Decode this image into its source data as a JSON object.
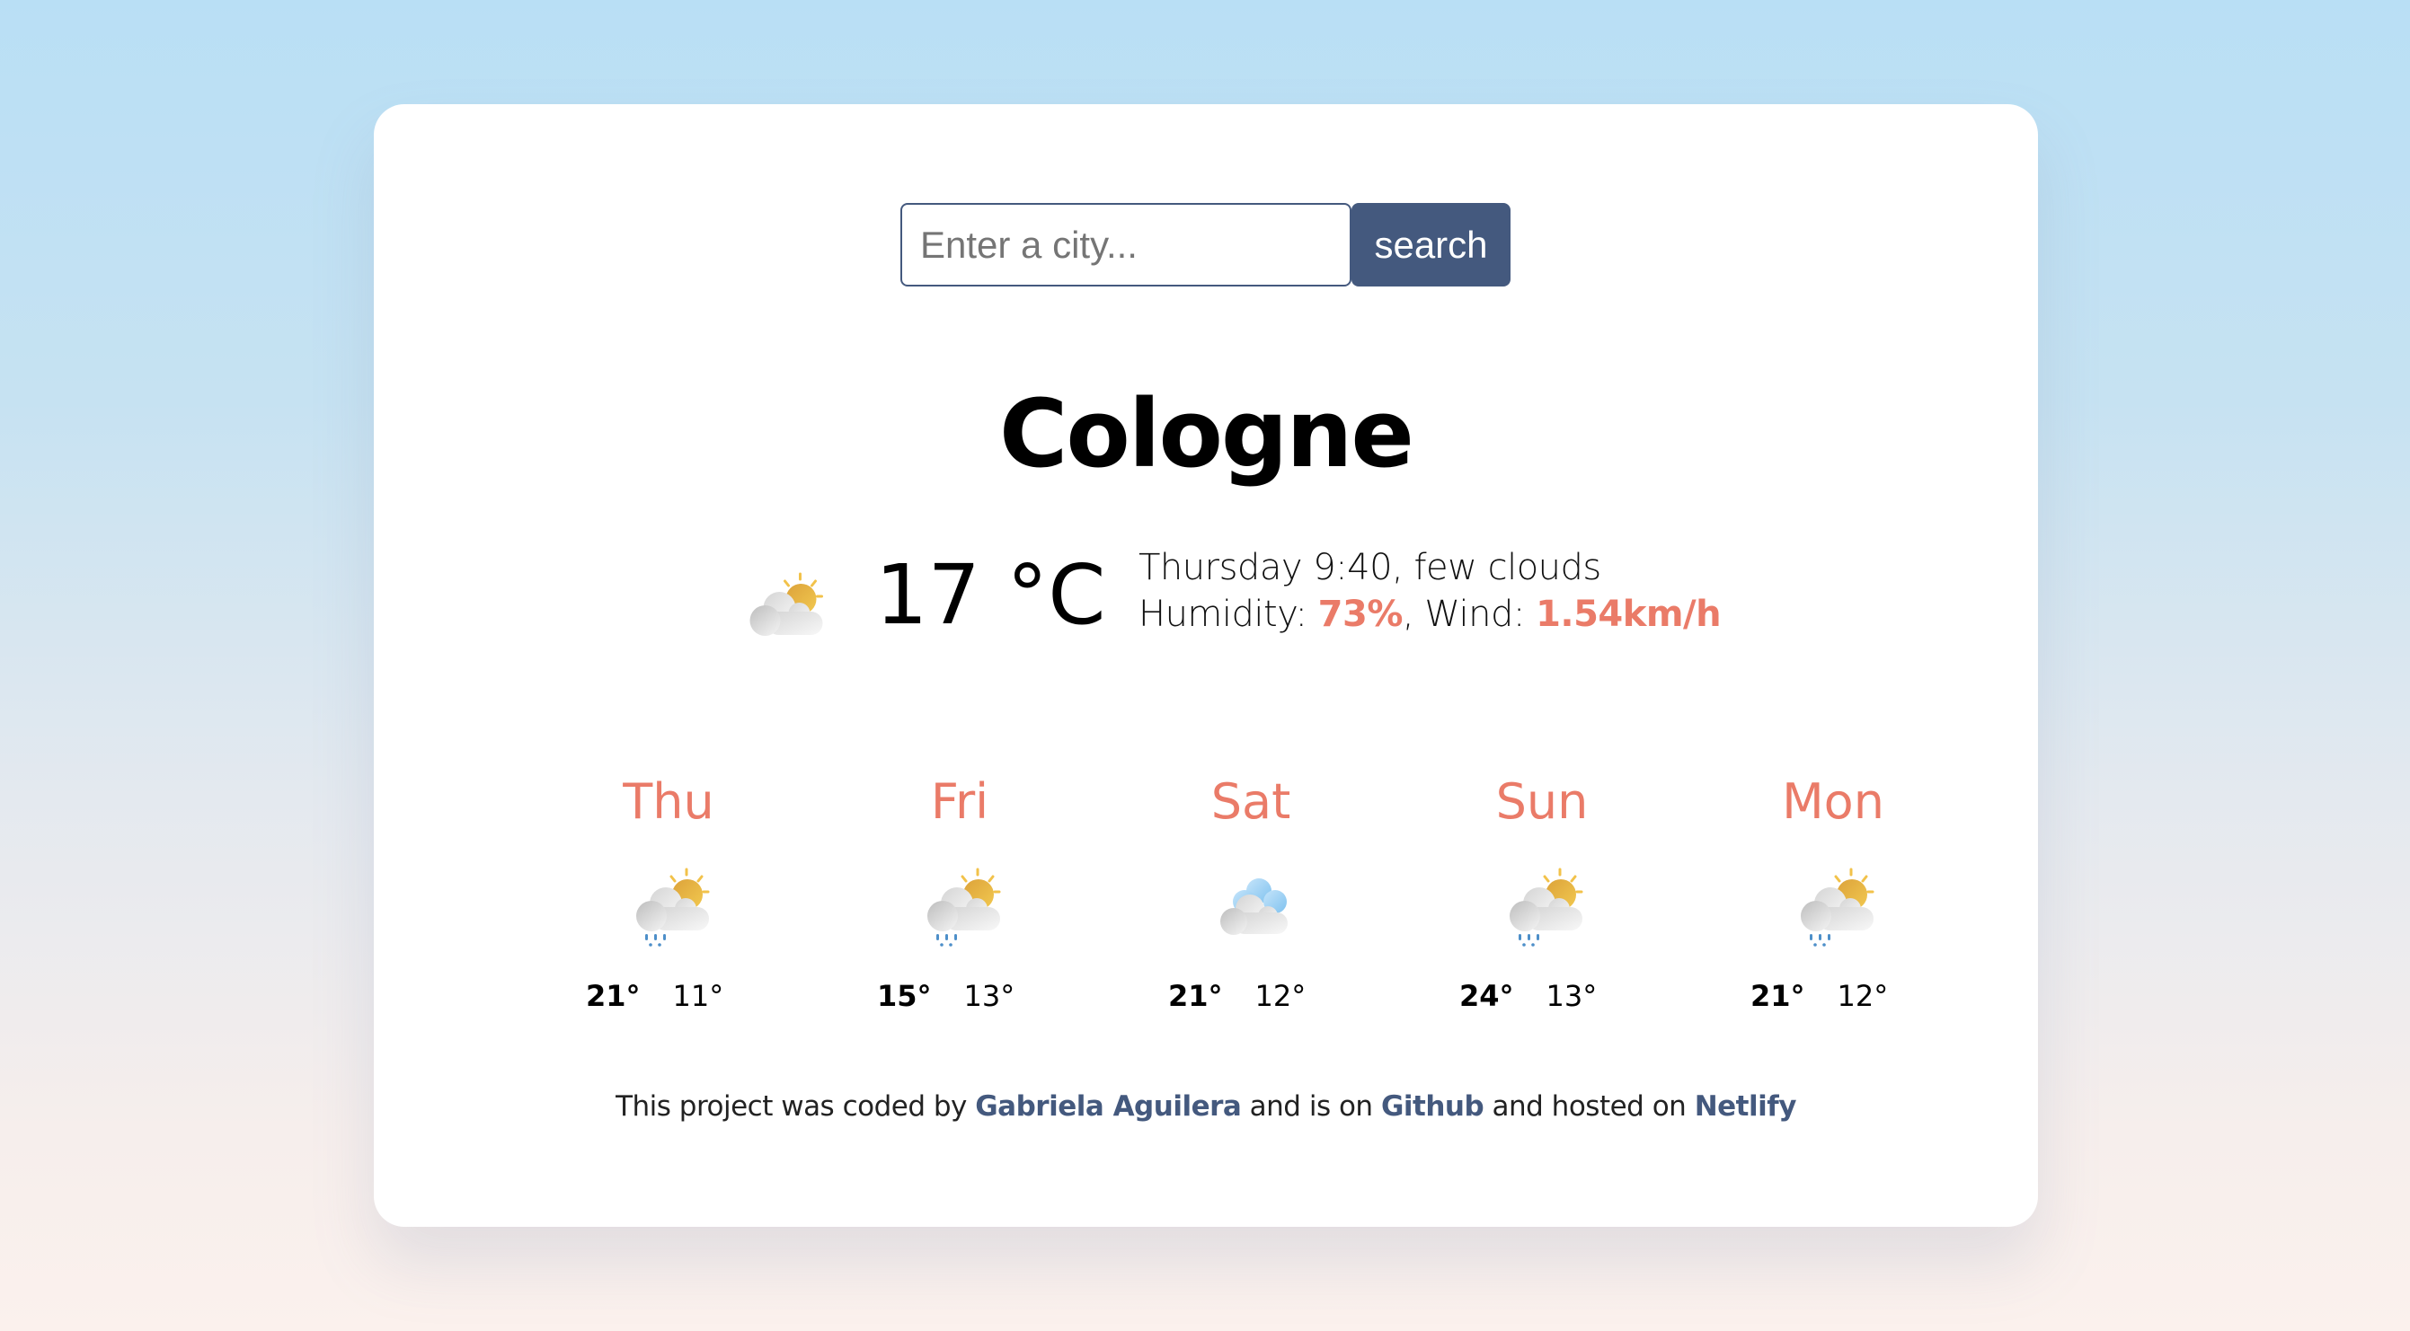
{
  "search": {
    "placeholder": "Enter a city...",
    "value": "",
    "button_label": "search"
  },
  "current": {
    "city": "Cologne",
    "icon": "few-clouds-icon",
    "temperature": "17",
    "unit": "°C",
    "temperature_display": "17 °C",
    "day_time": "Thursday 9:40",
    "description": "few clouds",
    "day_time_description": "Thursday 9:40, few clouds",
    "humidity_label": "Humidity: ",
    "humidity": "73%",
    "wind_label": ", Wind: ",
    "wind": "1.54km/h"
  },
  "forecast": [
    {
      "day": "Thu",
      "icon": "sun-cloud-rain-icon",
      "max": "21°",
      "min": "11°"
    },
    {
      "day": "Fri",
      "icon": "sun-cloud-rain-icon",
      "max": "15°",
      "min": "13°"
    },
    {
      "day": "Sat",
      "icon": "cloudy-icon",
      "max": "21°",
      "min": "12°"
    },
    {
      "day": "Sun",
      "icon": "sun-cloud-rain-icon",
      "max": "24°",
      "min": "13°"
    },
    {
      "day": "Mon",
      "icon": "sun-cloud-rain-icon",
      "max": "21°",
      "min": "12°"
    }
  ],
  "footer": {
    "text_1": "This project was coded by ",
    "author_link": "Gabriela Aguilera",
    "text_2": " and is on ",
    "github_link": "Github",
    "text_3": " and hosted on ",
    "netlify_link": "Netlify"
  },
  "colors": {
    "accent": "#ea7b68",
    "primary": "#44597e"
  }
}
